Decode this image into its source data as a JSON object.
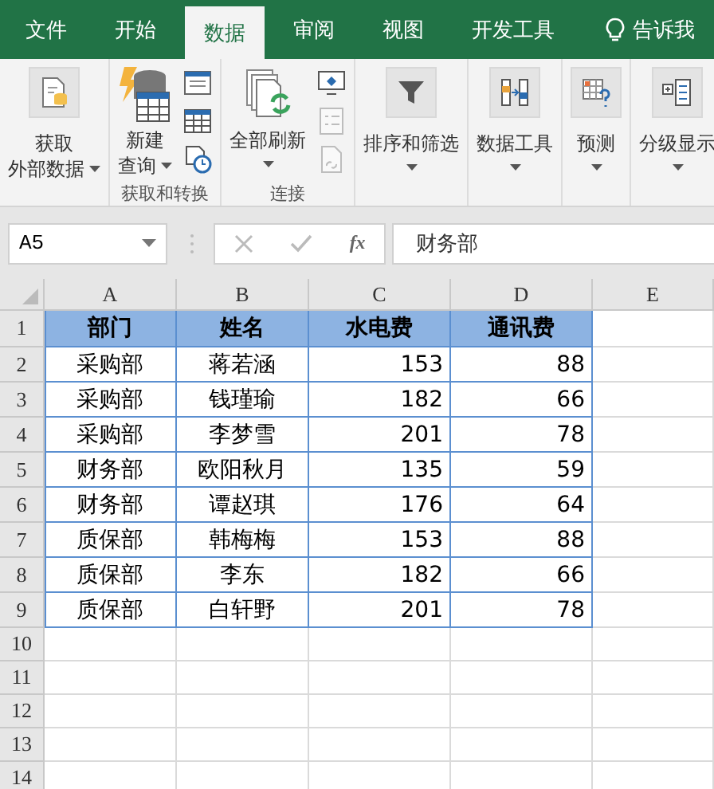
{
  "tabs": [
    {
      "label": "文件",
      "selected": false
    },
    {
      "label": "开始",
      "selected": false
    },
    {
      "label": "数据",
      "selected": true
    },
    {
      "label": "审阅",
      "selected": false
    },
    {
      "label": "视图",
      "selected": false
    },
    {
      "label": "开发工具",
      "selected": false
    }
  ],
  "tell_me": {
    "label": "告诉我"
  },
  "ribbon_groups": [
    {
      "large": [
        {
          "lines": [
            "获取",
            "外部数据"
          ],
          "dropdown": true
        }
      ]
    },
    {
      "label": "获取和转换",
      "large": [
        {
          "lines": [
            "新建",
            "查询"
          ],
          "dropdown": true
        }
      ],
      "small": [
        {
          "disabled": false
        },
        {
          "disabled": false
        },
        {
          "disabled": false
        }
      ]
    },
    {
      "label": "连接",
      "large": [
        {
          "lines": [
            "全部刷新"
          ],
          "dropdown": true
        }
      ],
      "small": [
        {
          "disabled": false
        },
        {
          "disabled": true
        },
        {
          "disabled": true
        }
      ]
    },
    {
      "large": [
        {
          "lines": [
            "排序和筛选"
          ],
          "dropdown": true
        }
      ]
    },
    {
      "large": [
        {
          "lines": [
            "数据工具"
          ],
          "dropdown": true
        }
      ]
    },
    {
      "large": [
        {
          "lines": [
            "预测"
          ],
          "dropdown": true
        }
      ]
    },
    {
      "large": [
        {
          "lines": [
            "分级显示"
          ],
          "dropdown": true
        }
      ]
    }
  ],
  "name_box": {
    "value": "A5"
  },
  "formula_bar": {
    "function_label": "fx",
    "value": "财务部"
  },
  "columns": [
    {
      "label": "A",
      "kind": "text"
    },
    {
      "label": "B",
      "kind": "text"
    },
    {
      "label": "C",
      "kind": "number"
    },
    {
      "label": "D",
      "kind": "number"
    },
    {
      "label": "E"
    }
  ],
  "rows": [
    {
      "number": "1",
      "header": true,
      "cells": [
        "部门",
        "姓名",
        "水电费",
        "通讯费"
      ]
    },
    {
      "number": "2",
      "header": false,
      "cells": [
        "采购部",
        "蒋若涵",
        "153",
        "88"
      ]
    },
    {
      "number": "3",
      "header": false,
      "cells": [
        "采购部",
        "钱瑾瑜",
        "182",
        "66"
      ]
    },
    {
      "number": "4",
      "header": false,
      "cells": [
        "采购部",
        "李梦雪",
        "201",
        "78"
      ]
    },
    {
      "number": "5",
      "header": false,
      "cells": [
        "财务部",
        "欧阳秋月",
        "135",
        "59"
      ]
    },
    {
      "number": "6",
      "header": false,
      "cells": [
        "财务部",
        "谭赵琪",
        "176",
        "64"
      ]
    },
    {
      "number": "7",
      "header": false,
      "cells": [
        "质保部",
        "韩梅梅",
        "153",
        "88"
      ]
    },
    {
      "number": "8",
      "header": false,
      "cells": [
        "质保部",
        "李东",
        "182",
        "66"
      ]
    },
    {
      "number": "9",
      "header": false,
      "cells": [
        "质保部",
        "白轩野",
        "201",
        "78"
      ]
    },
    {
      "number": "10",
      "header": false
    },
    {
      "number": "11",
      "header": false
    },
    {
      "number": "12",
      "header": false
    },
    {
      "number": "13",
      "header": false
    },
    {
      "number": "14",
      "header": false
    }
  ]
}
